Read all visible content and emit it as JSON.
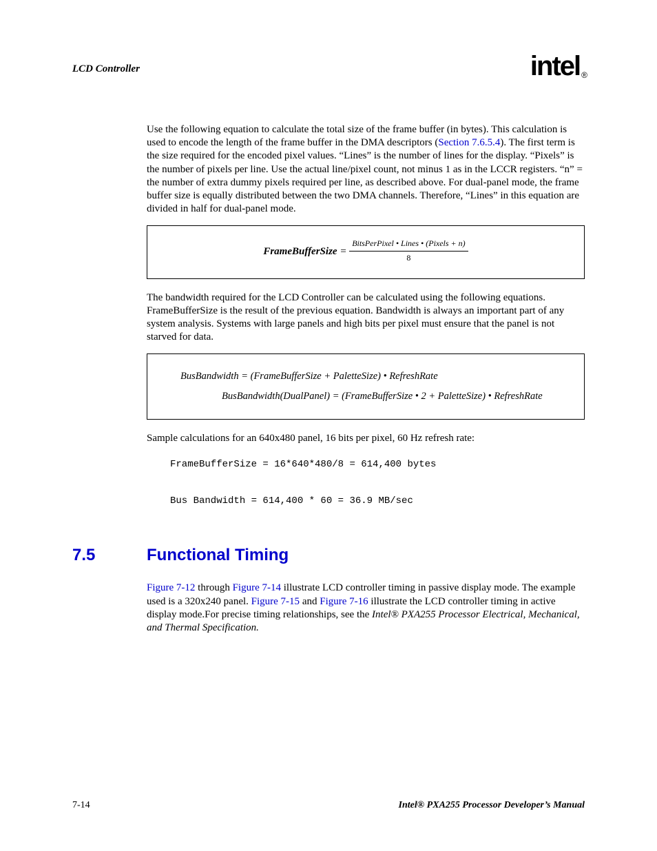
{
  "header": {
    "title": "LCD Controller",
    "logo_text": "intel",
    "logo_reg": "®"
  },
  "para1": {
    "t1": "Use the following equation to calculate the total size of the frame buffer (in bytes). This calculation is used to encode the length of the frame buffer in the DMA descriptors (",
    "link1": "Section 7.6.5.4",
    "t2": "). The first term is the size required for the encoded pixel values. “Lines” is the number of lines for the display. “Pixels” is the number of pixels per line. Use the actual line/pixel count, not minus 1 as in the LCCR registers. “n” = the number of extra dummy pixels required per line, as described above. For dual-panel mode, the frame buffer size is equally distributed between the two DMA channels. Therefore, “Lines” in this equation are divided in half for dual-panel mode."
  },
  "eq1": {
    "lhs": "FrameBufferSize",
    "eq": " = ",
    "num": "BitsPerPixel • Lines • (Pixels + n)",
    "den": "8"
  },
  "para2": "The bandwidth required for the LCD Controller can be calculated using the following equations. FrameBufferSize is the result of the previous equation. Bandwidth is always an important part of any system analysis. Systems with large panels and high bits per pixel must ensure that the panel is not starved for data.",
  "eq2": {
    "line1": "BusBandwidth = (FrameBufferSize + PaletteSize) • RefreshRate",
    "line2": "BusBandwidth(DualPanel) = (FrameBufferSize • 2 + PaletteSize) • RefreshRate"
  },
  "para3": "Sample calculations for an 640x480 panel, 16 bits per pixel, 60 Hz refresh rate:",
  "code": "FrameBufferSize = 16*640*480/8 = 614,400 bytes\n\nBus Bandwidth = 614,400 * 60 = 36.9 MB/sec",
  "section": {
    "num": "7.5",
    "title": "Functional Timing"
  },
  "para4": {
    "link1": "Figure 7-12",
    "t1": " through ",
    "link2": "Figure 7-14",
    "t2": " illustrate LCD controller timing in passive display mode. The example used is a 320x240 panel. ",
    "link3": "Figure 7-15",
    "t3": " and ",
    "link4": "Figure 7-16",
    "t4": " illustrate the LCD controller timing in active display mode.For precise timing relationships, see the ",
    "ital": "Intel® PXA255 Processor Electrical, Mechanical, and Thermal Specification."
  },
  "footer": {
    "left": "7-14",
    "right": "Intel® PXA255 Processor Developer’s Manual"
  }
}
